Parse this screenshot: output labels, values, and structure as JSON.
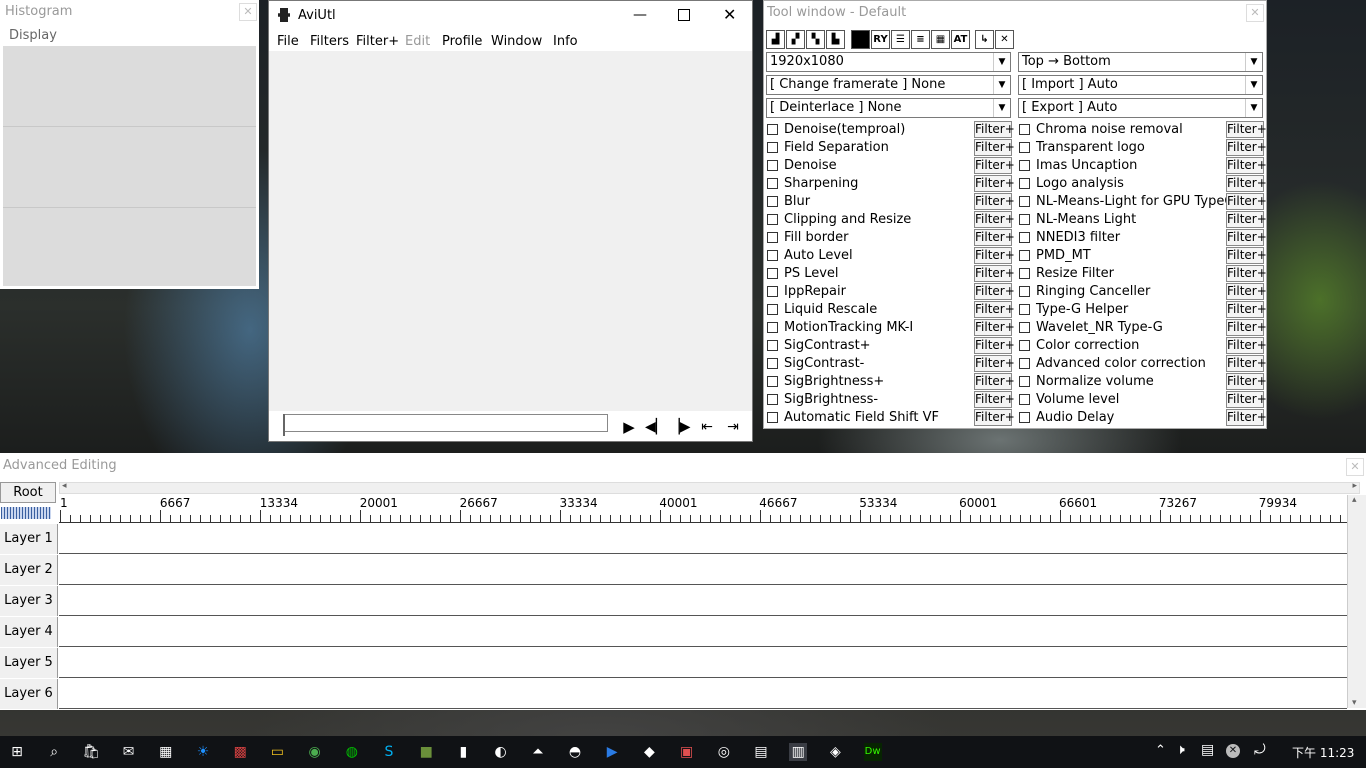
{
  "histogram": {
    "title": "Histogram",
    "menu": "Display"
  },
  "main": {
    "title": "AviUtl",
    "menu": [
      "File",
      "Filters",
      "Filter+",
      "Edit",
      "Profile",
      "Window",
      "Info"
    ]
  },
  "tool": {
    "title": "Tool window - Default",
    "icons": [
      "resize-icon-1",
      "resize-icon-2",
      "resize-icon-3",
      "resize-icon-4",
      "fill-icon",
      "ry-icon",
      "lines-icon-1",
      "lines-icon-2",
      "checker-icon",
      "at-icon",
      "arrow-icon",
      "close-x-icon"
    ],
    "combos": {
      "resolution": "1920x1080",
      "order": "Top → Bottom",
      "framerate": "[ Change framerate ] None",
      "import": "[ Import ] Auto",
      "deinterlace": "[ Deinterlace ] None",
      "export": "[ Export ] Auto"
    },
    "filter_btn": "Filter+",
    "left_filters": [
      "Denoise(temproal)",
      "Field Separation",
      "Denoise",
      "Sharpening",
      "Blur",
      "Clipping and Resize",
      "Fill border",
      "Auto Level",
      "PS Level",
      "IppRepair",
      "Liquid Rescale",
      "MotionTracking MK-I",
      "SigContrast+",
      "SigContrast-",
      "SigBrightness+",
      "SigBrightness-",
      "Automatic Field Shift VF"
    ],
    "right_filters": [
      "Chroma noise removal",
      "Transparent logo",
      "Imas Uncaption",
      "Logo analysis",
      "NL-Means-Light for GPU TypeC",
      "NL-Means Light",
      "NNEDI3 filter",
      "PMD_MT",
      "Resize Filter",
      "Ringing Canceller",
      "Type-G Helper",
      "Wavelet_NR Type-G",
      "Color correction",
      "Advanced color correction",
      "Normalize volume",
      "Volume level",
      "Audio Delay"
    ]
  },
  "timeline": {
    "title": "Advanced Editing",
    "root": "Root",
    "ruler": [
      "1",
      "6667",
      "13334",
      "20001",
      "26667",
      "33334",
      "40001",
      "46667",
      "53334",
      "60001",
      "66601",
      "73267",
      "79934"
    ],
    "layers": [
      "Layer  1",
      "Layer  2",
      "Layer  3",
      "Layer  4",
      "Layer  5",
      "Layer  6"
    ]
  },
  "taskbar": {
    "time": "下午 11:23",
    "icons": [
      "start-icon",
      "search-icon",
      "store-icon",
      "mail-icon",
      "calendar-icon",
      "weather-icon",
      "apps-icon",
      "explorer-icon",
      "chrome-icon",
      "line-icon",
      "skype-icon",
      "minecraft-icon",
      "stocks-icon",
      "paint-icon",
      "boat-icon",
      "gimp-icon",
      "player-icon",
      "fox-icon",
      "photo-icon",
      "brain-icon",
      "calculator-icon",
      "aviutl-icon",
      "media-icon",
      "dreamweaver-icon"
    ]
  }
}
